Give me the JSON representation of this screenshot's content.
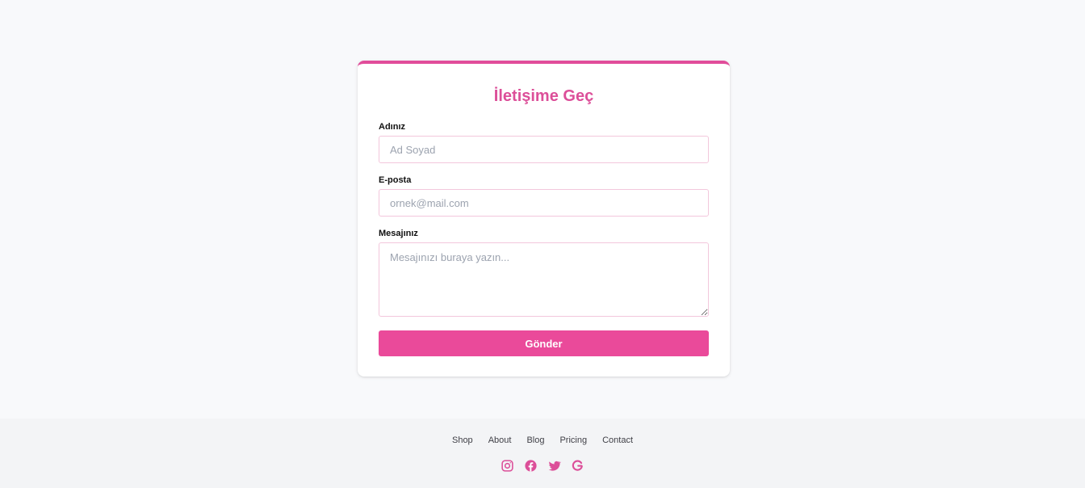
{
  "contact_form": {
    "title": "İletişime Geç",
    "name_label": "Adınız",
    "name_placeholder": "Ad Soyad",
    "email_label": "E-posta",
    "email_placeholder": "ornek@mail.com",
    "message_label": "Mesajınız",
    "message_placeholder": "Mesajınızı buraya yazın...",
    "submit_label": "Gönder"
  },
  "footer": {
    "links": [
      "Shop",
      "About",
      "Blog",
      "Pricing",
      "Contact"
    ],
    "social_icons": [
      "instagram-icon",
      "facebook-icon",
      "twitter-icon",
      "google-icon"
    ]
  },
  "colors": {
    "accent": "#ea4a9a",
    "title": "#dc4f99",
    "page_background": "#f8f9fb",
    "footer_background": "#f3f4f6",
    "input_border": "#f3c7dc"
  }
}
